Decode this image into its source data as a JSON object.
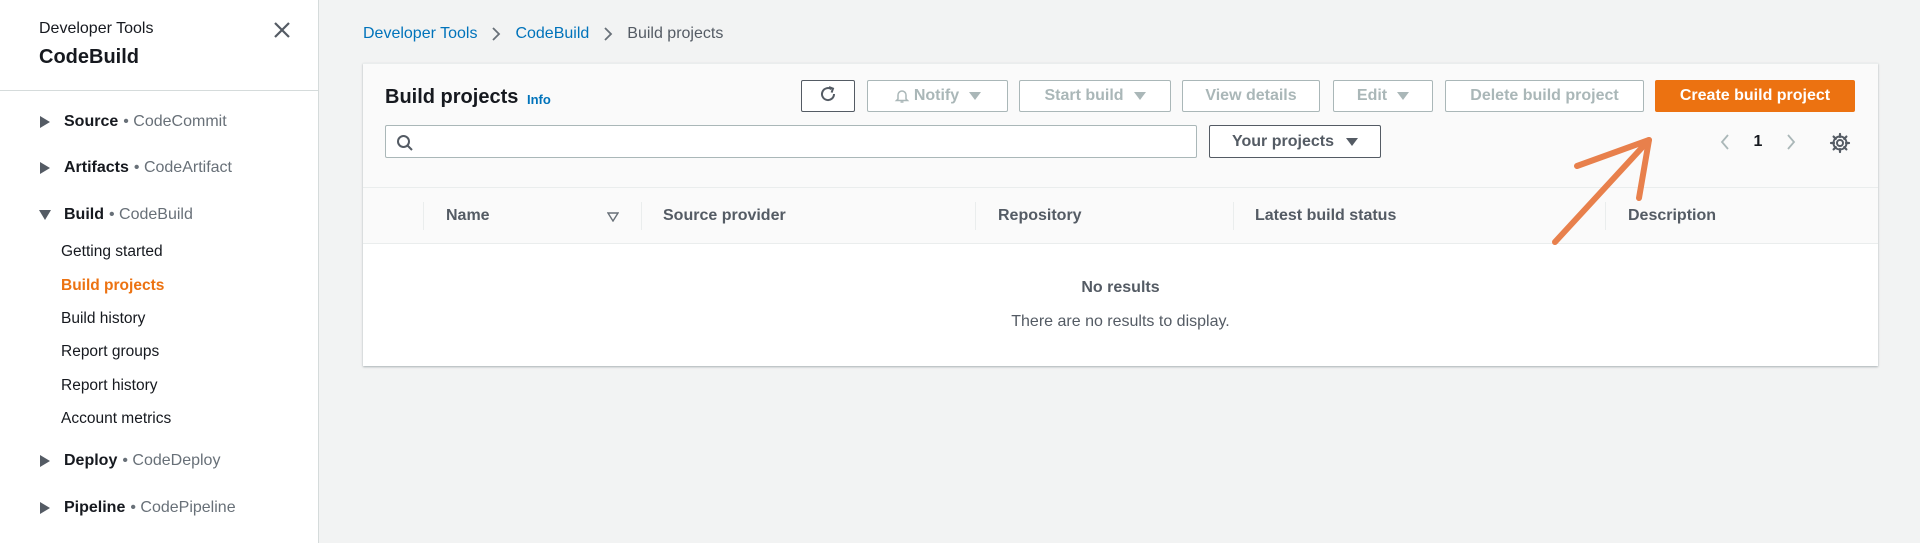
{
  "sidebar": {
    "service": "Developer Tools",
    "app": "CodeBuild",
    "groups": [
      {
        "name": "Source",
        "sub": "• CodeCommit"
      },
      {
        "name": "Artifacts",
        "sub": "• CodeArtifact"
      },
      {
        "name": "Build",
        "sub": "• CodeBuild"
      },
      {
        "name": "Deploy",
        "sub": "• CodeDeploy"
      },
      {
        "name": "Pipeline",
        "sub": "• CodePipeline"
      }
    ],
    "build_items": [
      "Getting started",
      "Build projects",
      "Build history",
      "Report groups",
      "Report history",
      "Account metrics"
    ]
  },
  "breadcrumb": {
    "items": [
      "Developer Tools",
      "CodeBuild",
      "Build projects"
    ]
  },
  "panel": {
    "title": "Build projects",
    "info": "Info",
    "buttons": {
      "notify": "Notify",
      "start_build": "Start build",
      "view_details": "View details",
      "edit": "Edit",
      "delete": "Delete build project",
      "create": "Create build project"
    },
    "search_placeholder": "",
    "filter": "Your projects",
    "page": "1",
    "columns": [
      "Name",
      "Source provider",
      "Repository",
      "Latest build status",
      "Description"
    ],
    "empty_title": "No results",
    "empty_desc": "There are no results to display."
  },
  "colors": {
    "accent": "#ec7211",
    "link": "#0073bb",
    "annotation_arrow": "#e8804c"
  },
  "icons": [
    "close-icon",
    "caret-right-icon",
    "caret-down-icon",
    "chevron-right-icon",
    "refresh-icon",
    "bell-icon",
    "triangle-down-icon",
    "search-icon",
    "chevron-left-icon",
    "gear-icon",
    "sort-icon",
    "arrow-annotation-icon"
  ]
}
